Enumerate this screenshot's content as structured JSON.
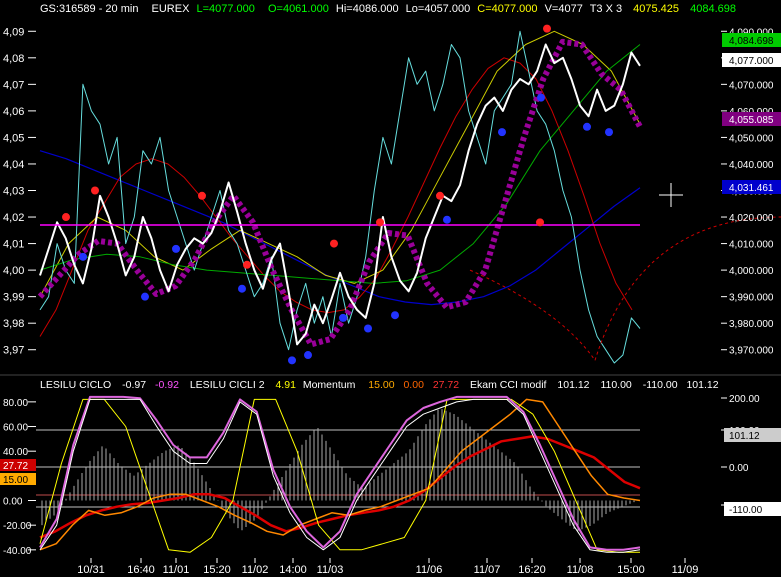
{
  "header": {
    "symbol": "GS:316589 - 20 min",
    "exchange": "EUREX",
    "last": "L=4077.000",
    "open": "O=4061.000",
    "high": "Hi=4086.000",
    "low": "Lo=4057.000",
    "close": "C=4077.000",
    "volume": "V=4077",
    "bar_type": "T3 X 3",
    "value_a": "4075.425",
    "value_b": "4084.698"
  },
  "indicator_header": {
    "ind1_name": "LESILU CICLO",
    "ind1_v1": "-0.97",
    "ind1_v2": "-0.92",
    "ind2_name": "LESILU CICLI 2",
    "ind2_v1": "4.91",
    "ind2_name2": "Momentum",
    "ind2_v2": "15.00",
    "ind2_v3": "0.00",
    "ind2_v4": "27.72",
    "ind3_name": "Ekam CCI modif",
    "ind3_v1": "101.12",
    "ind3_v2": "110.00",
    "ind3_v3": "-110.00",
    "ind3_v4": "101.12"
  },
  "chart_data": [
    {
      "type": "line",
      "ylim": [
        3.965,
        4.095
      ],
      "y_ticks_left": [
        "4,09",
        "4,08",
        "4,07",
        "4,06",
        "4,05",
        "4,04",
        "4,03",
        "4,02",
        "4,01",
        "4,00",
        "3,99",
        "3,98",
        "3,97"
      ],
      "y_ticks_right": [
        "4,090.000",
        "4,080.000",
        "4,070.000",
        "4,060.000",
        "4,050.000",
        "4,040.000",
        "4,030.000",
        "4,020.000",
        "4,010.000",
        "4,000.000",
        "3,990.000",
        "3,980.000",
        "3,970.000"
      ],
      "flags": [
        {
          "label": "4,084.698",
          "color": "#00cc00",
          "text_color": "#000000"
        },
        {
          "label": "4,077.000",
          "color": "#ffffff",
          "text_color": "#000000"
        },
        {
          "label": "4,055.085",
          "color": "#800080",
          "text_color": "#ffffff"
        },
        {
          "label": "4,031.461",
          "color": "#0000cc",
          "text_color": "#ffffff"
        }
      ],
      "series": [
        {
          "color": "#ffffff",
          "values": [
            3.998,
            4.008,
            4.018,
            4.012,
            4.002,
            3.995,
            4.008,
            4.028,
            4.02,
            4.01,
            3.998,
            4.005,
            4.02,
            4.012,
            4.0,
            3.992,
            4.002,
            4.008,
            4.012,
            4.01,
            4.014,
            4.022,
            4.033,
            4.022,
            4.01,
            4.0,
            3.993,
            4.004,
            4.01,
            3.992,
            3.972,
            3.976,
            3.987,
            3.98,
            3.989,
            3.999,
            3.99,
            3.985,
            3.982,
            3.995,
            4.02,
            4.005,
            3.996,
            3.992,
            3.999,
            4.012,
            4.02,
            4.028,
            4.026,
            4.032,
            4.045,
            4.055,
            4.062,
            4.065,
            4.06,
            4.068,
            4.072,
            4.07,
            4.075,
            4.085,
            4.078,
            4.08,
            4.072,
            4.062,
            4.058,
            4.068,
            4.06,
            4.062,
            4.07,
            4.082,
            4.077
          ]
        },
        {
          "color": "#66dddd",
          "values": [
            3.985,
            3.99,
            4.01,
            4.0,
            3.995,
            4.07,
            4.06,
            4.055,
            4.04,
            4.05,
            4.01,
            4.02,
            4.045,
            4.04,
            4.05,
            4.03,
            4.02,
            4.01,
            4.0,
            4.01,
            4.02,
            4.03,
            4.015,
            4.01,
            4.0,
            3.99,
            3.995,
            4.005,
            3.98,
            3.97,
            3.985,
            3.995,
            3.98,
            3.99,
            3.975,
            3.995,
            3.98,
            3.99,
            4.005,
            4.03,
            4.05,
            4.04,
            4.06,
            4.08,
            4.07,
            4.075,
            4.06,
            4.07,
            4.085,
            4.08,
            4.06,
            4.05,
            4.04,
            4.06,
            4.065,
            4.07,
            4.09,
            4.075,
            4.06,
            4.055,
            4.045,
            4.03,
            4.02,
            4.0,
            3.985,
            3.975,
            3.97,
            3.965,
            3.968,
            3.982,
            3.978
          ]
        },
        {
          "color": "#cc0000",
          "values": [
            3.975,
            3.985,
            4.0,
            4.015,
            4.025,
            4.035,
            4.04,
            4.042,
            4.04,
            4.035,
            4.028,
            4.02,
            4.012,
            4.005,
            3.998,
            3.992,
            3.988,
            3.985,
            3.984,
            3.985,
            3.99,
            3.997,
            4.008,
            4.02,
            4.033,
            4.046,
            4.058,
            4.068,
            4.076,
            4.08,
            4.078,
            4.072,
            4.06,
            4.045,
            4.028,
            4.01,
            3.995,
            3.985
          ]
        },
        {
          "color": "#0000cc",
          "values": [
            4.045,
            4.042,
            4.038,
            4.034,
            4.03,
            4.026,
            4.022,
            4.018,
            4.013,
            4.008,
            4.003,
            3.998,
            3.994,
            3.99,
            3.988,
            3.987,
            3.988,
            3.99,
            3.994,
            4.0,
            4.008,
            4.016,
            4.024,
            4.031
          ]
        },
        {
          "color": "#cccc00",
          "values": [
            3.99,
            4.01,
            4.02,
            4.015,
            4.005,
            4.0,
            4.008,
            4.015,
            4.01,
            4.005,
            3.998,
            3.995,
            4.0,
            4.015,
            4.035,
            4.055,
            4.075,
            4.085,
            4.09,
            4.085,
            4.075,
            4.055
          ]
        },
        {
          "color": "#00aa00",
          "values": [
            4.0,
            4.004,
            4.006,
            4.005,
            4.002,
            4.0,
            3.999,
            3.998,
            3.997,
            3.996,
            3.995,
            3.996,
            4.0,
            4.01,
            4.025,
            4.045,
            4.06,
            4.075,
            4.085
          ]
        },
        {
          "color": "#990099",
          "values": [
            3.99,
            3.998,
            4.006,
            4.011,
            4.01,
            4.0,
            3.991,
            3.994,
            4.004,
            4.018,
            4.028,
            4.018,
            4.0,
            3.985,
            3.972,
            3.974,
            3.985,
            4.003,
            4.014,
            4.013,
            3.995,
            3.986,
            3.988,
            4.0,
            4.025,
            4.05,
            4.072,
            4.086,
            4.085,
            4.074,
            4.068,
            4.054
          ]
        },
        {
          "color": "#ff00ff",
          "values": [
            4.017,
            4.017
          ]
        }
      ],
      "markers": {
        "red": [
          4.02,
          4.03,
          4.028,
          4.002,
          4.01,
          4.018,
          4.028,
          4.018,
          4.091
        ],
        "blue": [
          4.005,
          3.99,
          4.008,
          3.993,
          3.966,
          3.968,
          3.982,
          3.978,
          3.983,
          4.019,
          4.052,
          4.065,
          4.054,
          4.052
        ]
      }
    },
    {
      "type": "line",
      "ylim": [
        -45,
        88
      ],
      "y_ticks_left": [
        "80.00",
        "60.00",
        "40.00",
        "20.00",
        "0.00",
        "-20.00",
        "-40.00"
      ],
      "y_ticks_right": [
        "200.00",
        "100.00",
        "0.00",
        "-100.00"
      ],
      "left_flags": [
        {
          "label": "27.72",
          "color": "#cc0000",
          "text_color": "#ffffff"
        },
        {
          "label": "15.00",
          "color": "#ffaa00",
          "text_color": "#000000"
        }
      ],
      "right_flags": [
        {
          "label": "101.12",
          "color": "#cccccc",
          "text_color": "#000000"
        },
        {
          "label": "-110.00",
          "color": "#ffffff",
          "text_color": "#000000"
        }
      ],
      "series": [
        {
          "color": "#ffffff",
          "values": [
            -40,
            -20,
            40,
            82,
            82,
            82,
            82,
            60,
            40,
            30,
            30,
            50,
            80,
            70,
            20,
            -10,
            -30,
            -40,
            -30,
            0,
            20,
            40,
            60,
            70,
            75,
            80,
            82,
            82,
            82,
            70,
            40,
            10,
            -20,
            -40,
            -42,
            -42,
            -40
          ]
        },
        {
          "color": "#dd66dd",
          "values": [
            -38,
            -15,
            45,
            84,
            84,
            84,
            83,
            65,
            45,
            35,
            35,
            55,
            82,
            72,
            25,
            -5,
            -25,
            -38,
            -25,
            5,
            25,
            45,
            65,
            75,
            80,
            84,
            84,
            84,
            84,
            72,
            45,
            15,
            -15,
            -38,
            -40,
            -40,
            -38
          ]
        },
        {
          "color": "#ffff00",
          "values": [
            -35,
            30,
            82,
            82,
            60,
            10,
            -40,
            -42,
            -30,
            0,
            82,
            82,
            40,
            -20,
            -40,
            -40,
            -35,
            -30,
            0,
            82,
            82,
            82,
            82,
            70,
            40,
            0,
            -40,
            -42,
            -42
          ]
        },
        {
          "color": "#ff8800",
          "values": [
            -40,
            -35,
            -20,
            -8,
            -12,
            -10,
            -5,
            2,
            5,
            5,
            0,
            -5,
            -12,
            -18,
            -25,
            -28,
            -20,
            -15,
            -10,
            -12,
            -8,
            -5,
            0,
            5,
            10,
            25,
            40,
            50,
            60,
            70,
            82,
            80,
            60,
            40,
            20,
            5,
            2,
            0
          ]
        },
        {
          "color": "#dd0000",
          "values": [
            -30,
            -25,
            -18,
            -12,
            -8,
            -5,
            -3,
            -2,
            0,
            2,
            5,
            5,
            2,
            -5,
            -12,
            -20,
            -25,
            -22,
            -18,
            -15,
            -12,
            -10,
            -8,
            -5,
            0,
            8,
            18,
            28,
            36,
            42,
            48,
            50,
            52,
            50,
            45,
            40,
            35,
            25,
            15,
            10
          ]
        },
        {
          "color": "#aaaaaa",
          "values": [
            -20,
            -10,
            10,
            30,
            45,
            30,
            20,
            30,
            40,
            45,
            30,
            10,
            -10,
            -25,
            -15,
            5,
            25,
            45,
            60,
            40,
            20,
            10,
            20,
            30,
            40,
            60,
            75,
            70,
            60,
            50,
            40,
            30,
            10,
            -5,
            -15,
            -25,
            -20,
            -10,
            -5,
            0
          ]
        }
      ]
    }
  ],
  "x_axis": {
    "labels": [
      "10/31",
      "16:40",
      "11/01",
      "15:20",
      "11/02",
      "14:00",
      "11/03",
      "11/06",
      "11/07",
      "16:20",
      "11/08",
      "15:00",
      "11/09"
    ]
  }
}
